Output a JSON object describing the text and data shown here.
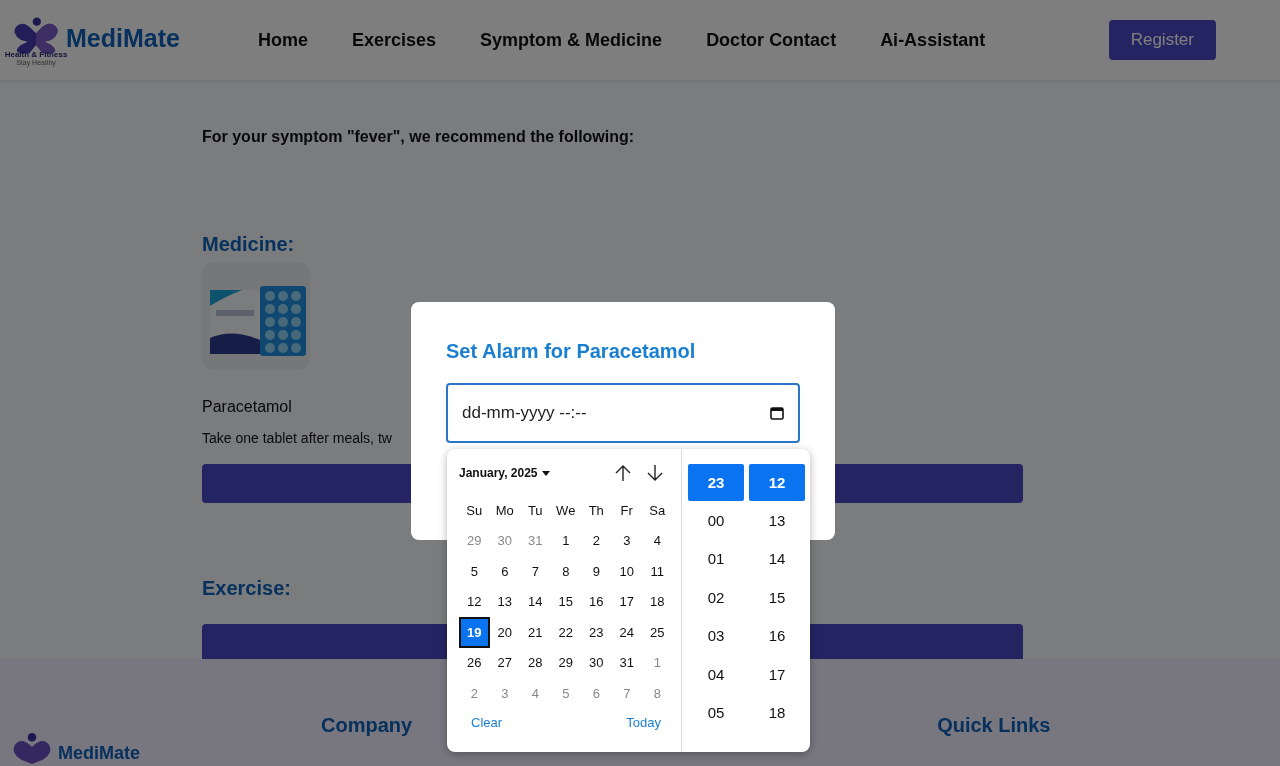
{
  "header": {
    "brand": "MediMate",
    "tagline": "Health & Fitness",
    "motto": "Stay Healthy",
    "nav": [
      {
        "label": "Home"
      },
      {
        "label": "Exercises"
      },
      {
        "label": "Symptom & Medicine"
      },
      {
        "label": "Doctor Contact"
      },
      {
        "label": "Ai-Assistant"
      }
    ],
    "register": "Register"
  },
  "content": {
    "intro": "For your symptom \"fever\", we recommend the following:",
    "medicine_heading": "Medicine:",
    "medicine": {
      "name": "Paracetamol",
      "instructions": "Take one tablet after meals, tw"
    },
    "exercise_heading": "Exercise:"
  },
  "footer": {
    "brand": "MediMate",
    "columns": [
      {
        "heading": "Company"
      },
      {
        "heading": "Quick Links"
      }
    ]
  },
  "modal": {
    "title": "Set Alarm for Paracetamol",
    "field_value": "dd-mm-yyyy --:--",
    "picker": {
      "month": "January, 2025",
      "weekdays": [
        "Su",
        "Mo",
        "Tu",
        "We",
        "Th",
        "Fr",
        "Sa"
      ],
      "days": [
        {
          "label": "29",
          "outside": true,
          "selected": false
        },
        {
          "label": "30",
          "outside": true,
          "selected": false
        },
        {
          "label": "31",
          "outside": true,
          "selected": false
        },
        {
          "label": "1",
          "outside": false,
          "selected": false
        },
        {
          "label": "2",
          "outside": false,
          "selected": false
        },
        {
          "label": "3",
          "outside": false,
          "selected": false
        },
        {
          "label": "4",
          "outside": false,
          "selected": false
        },
        {
          "label": "5",
          "outside": false,
          "selected": false
        },
        {
          "label": "6",
          "outside": false,
          "selected": false
        },
        {
          "label": "7",
          "outside": false,
          "selected": false
        },
        {
          "label": "8",
          "outside": false,
          "selected": false
        },
        {
          "label": "9",
          "outside": false,
          "selected": false
        },
        {
          "label": "10",
          "outside": false,
          "selected": false
        },
        {
          "label": "11",
          "outside": false,
          "selected": false
        },
        {
          "label": "12",
          "outside": false,
          "selected": false
        },
        {
          "label": "13",
          "outside": false,
          "selected": false
        },
        {
          "label": "14",
          "outside": false,
          "selected": false
        },
        {
          "label": "15",
          "outside": false,
          "selected": false
        },
        {
          "label": "16",
          "outside": false,
          "selected": false
        },
        {
          "label": "17",
          "outside": false,
          "selected": false
        },
        {
          "label": "18",
          "outside": false,
          "selected": false
        },
        {
          "label": "19",
          "outside": false,
          "selected": true
        },
        {
          "label": "20",
          "outside": false,
          "selected": false
        },
        {
          "label": "21",
          "outside": false,
          "selected": false
        },
        {
          "label": "22",
          "outside": false,
          "selected": false
        },
        {
          "label": "23",
          "outside": false,
          "selected": false
        },
        {
          "label": "24",
          "outside": false,
          "selected": false
        },
        {
          "label": "25",
          "outside": false,
          "selected": false
        },
        {
          "label": "26",
          "outside": false,
          "selected": false
        },
        {
          "label": "27",
          "outside": false,
          "selected": false
        },
        {
          "label": "28",
          "outside": false,
          "selected": false
        },
        {
          "label": "29",
          "outside": false,
          "selected": false
        },
        {
          "label": "30",
          "outside": false,
          "selected": false
        },
        {
          "label": "31",
          "outside": false,
          "selected": false
        },
        {
          "label": "1",
          "outside": true,
          "selected": false
        },
        {
          "label": "2",
          "outside": true,
          "selected": false
        },
        {
          "label": "3",
          "outside": true,
          "selected": false
        },
        {
          "label": "4",
          "outside": true,
          "selected": false
        },
        {
          "label": "5",
          "outside": true,
          "selected": false
        },
        {
          "label": "6",
          "outside": true,
          "selected": false
        },
        {
          "label": "7",
          "outside": true,
          "selected": false
        },
        {
          "label": "8",
          "outside": true,
          "selected": false
        }
      ],
      "clear": "Clear",
      "today": "Today",
      "hours": [
        {
          "label": "23",
          "selected": true
        },
        {
          "label": "00",
          "selected": false
        },
        {
          "label": "01",
          "selected": false
        },
        {
          "label": "02",
          "selected": false
        },
        {
          "label": "03",
          "selected": false
        },
        {
          "label": "04",
          "selected": false
        },
        {
          "label": "05",
          "selected": false
        }
      ],
      "minutes": [
        {
          "label": "12",
          "selected": true
        },
        {
          "label": "13",
          "selected": false
        },
        {
          "label": "14",
          "selected": false
        },
        {
          "label": "15",
          "selected": false
        },
        {
          "label": "16",
          "selected": false
        },
        {
          "label": "17",
          "selected": false
        },
        {
          "label": "18",
          "selected": false
        }
      ]
    }
  }
}
